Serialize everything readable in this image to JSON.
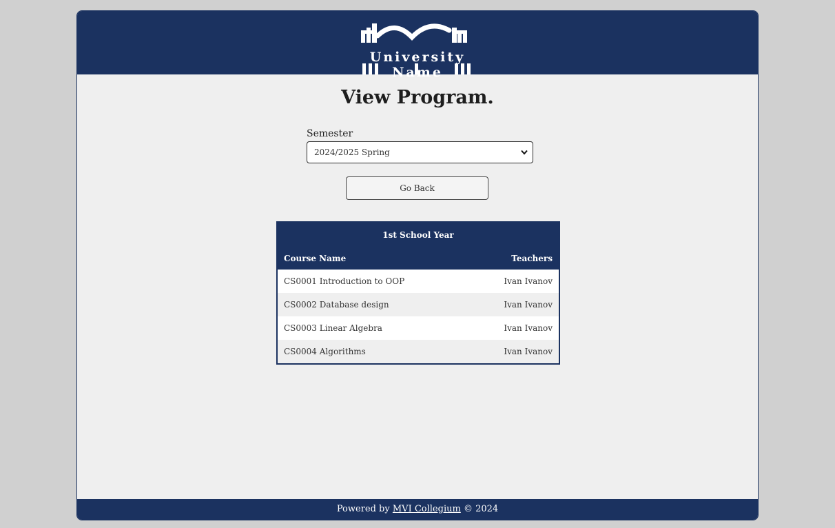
{
  "header": {
    "logo_text": "University Name"
  },
  "page": {
    "title": "View Program."
  },
  "semester": {
    "label": "Semester",
    "selected": "2024/2025 Spring"
  },
  "actions": {
    "go_back_label": "Go Back"
  },
  "program_table": {
    "year_label": "1st School Year",
    "columns": [
      "Course Name",
      "Teachers"
    ],
    "rows": [
      {
        "course": "CS0001 Introduction to OOP",
        "teacher": "Ivan Ivanov"
      },
      {
        "course": "CS0002 Database design",
        "teacher": "Ivan Ivanov"
      },
      {
        "course": "CS0003 Linear Algebra",
        "teacher": "Ivan Ivanov"
      },
      {
        "course": "CS0004 Algorithms",
        "teacher": "Ivan Ivanov"
      }
    ]
  },
  "footer": {
    "prefix": "Powered by",
    "link_text": "MVI Collegium",
    "suffix": "© 2024"
  },
  "colors": {
    "brand_navy": "#1b3260",
    "page_bg": "#d0d0d0",
    "content_bg": "#efefef"
  }
}
